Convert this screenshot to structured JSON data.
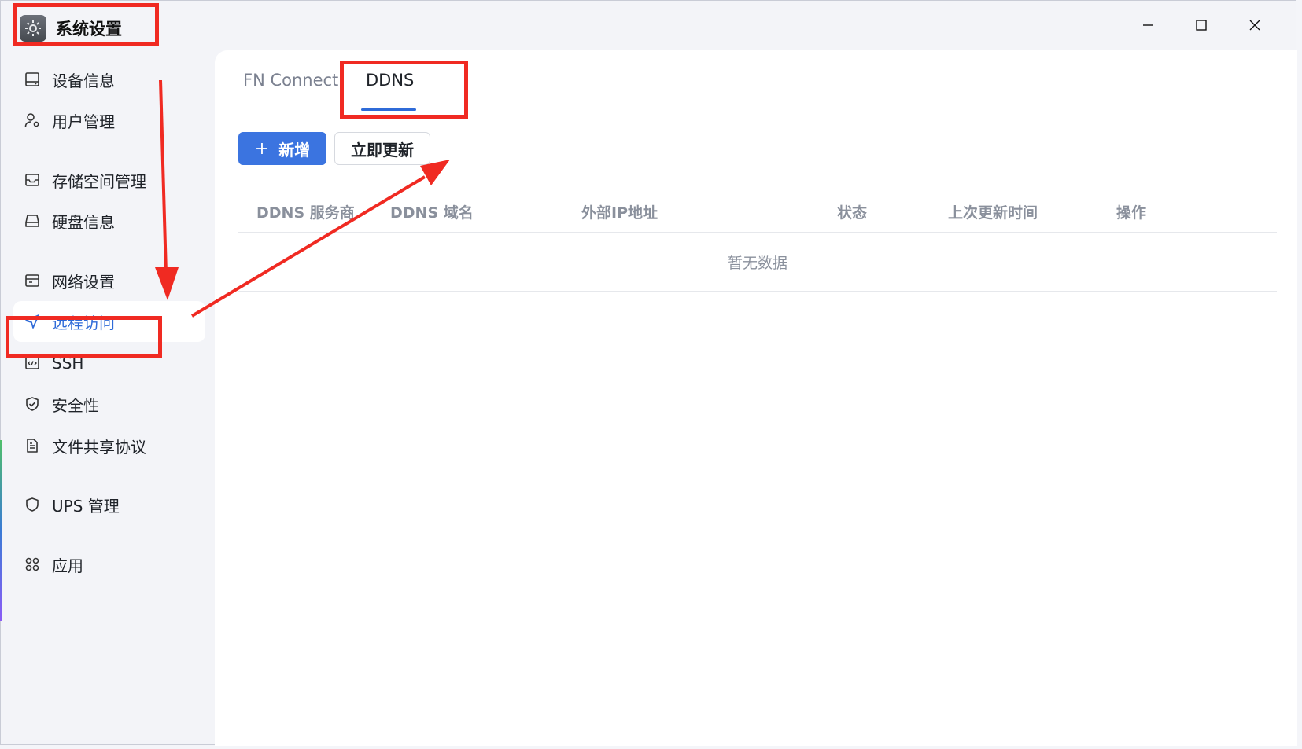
{
  "window": {
    "title": "系统设置",
    "controls": [
      "minimize-icon",
      "maximize-icon",
      "close-icon"
    ]
  },
  "sidebar": {
    "items": [
      {
        "label": "设备信息",
        "icon": "device-icon",
        "active": false
      },
      {
        "label": "用户管理",
        "icon": "user-gear-icon",
        "active": false
      },
      {
        "label": "存储空间管理",
        "icon": "storage-icon",
        "active": false
      },
      {
        "label": "硬盘信息",
        "icon": "disk-icon",
        "active": false
      },
      {
        "label": "网络设置",
        "icon": "network-icon",
        "active": false
      },
      {
        "label": "远程访问",
        "icon": "send-icon",
        "active": true
      },
      {
        "label": "SSH",
        "icon": "code-icon",
        "active": false
      },
      {
        "label": "安全性",
        "icon": "shield-check-icon",
        "active": false
      },
      {
        "label": "文件共享协议",
        "icon": "file-icon",
        "active": false
      },
      {
        "label": "UPS 管理",
        "icon": "shield-icon",
        "active": false
      },
      {
        "label": "应用",
        "icon": "apps-icon",
        "active": false
      }
    ]
  },
  "main": {
    "tabs": [
      {
        "label": "FN Connect",
        "active": false
      },
      {
        "label": "DDNS",
        "active": true
      }
    ],
    "toolbar": {
      "add_label": "新增",
      "add_icon": "plus-icon",
      "refresh_label": "立即更新"
    },
    "table": {
      "columns": [
        "DDNS 服务商",
        "DDNS 域名",
        "外部IP地址",
        "状态",
        "上次更新时间",
        "操作"
      ],
      "rows": [],
      "empty_text": "暂无数据"
    }
  },
  "colors": {
    "accent": "#3b74e0",
    "active_text": "#2f6bd8",
    "annotation": "#f02a22",
    "background": "#f3f4f8"
  }
}
